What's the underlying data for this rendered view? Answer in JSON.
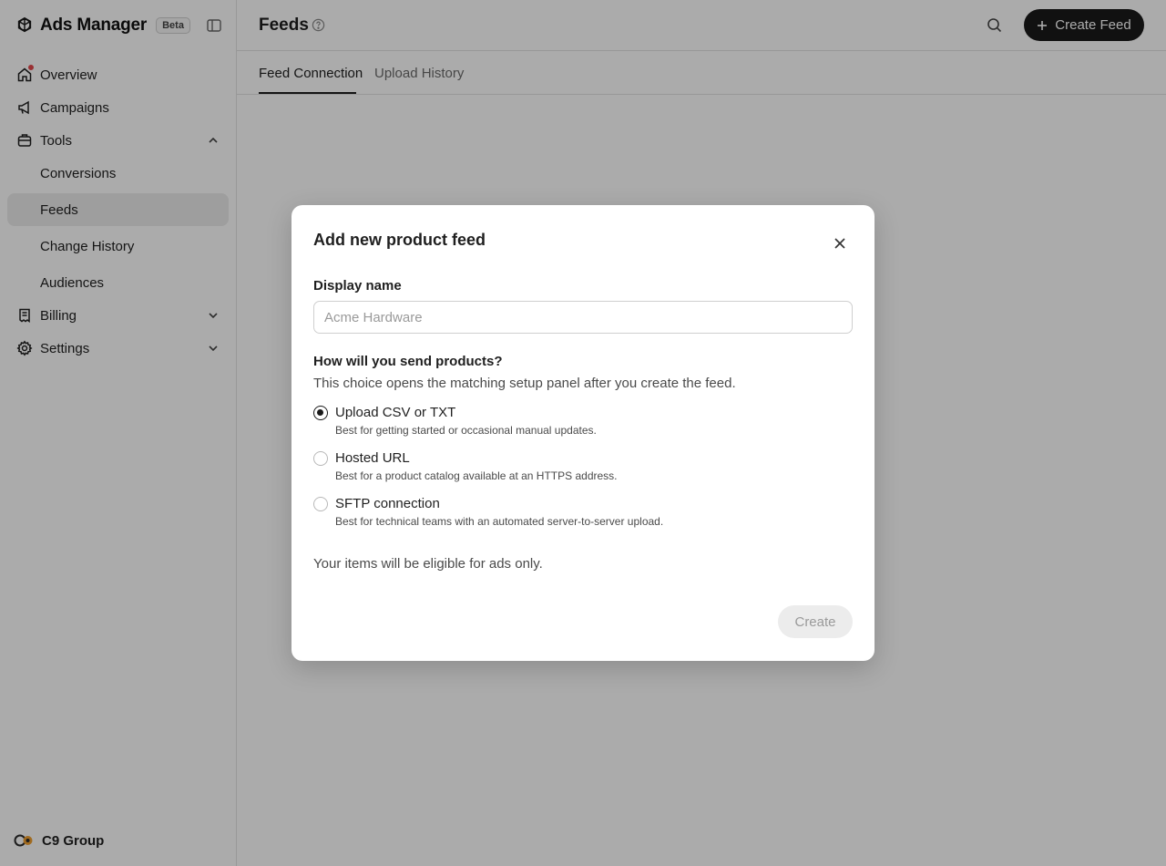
{
  "app": {
    "title": "Ads Manager",
    "badge": "Beta"
  },
  "sidebar": {
    "items": [
      {
        "label": "Overview",
        "icon": "home-icon"
      },
      {
        "label": "Campaigns",
        "icon": "megaphone-icon"
      },
      {
        "label": "Tools",
        "icon": "toolbox-icon",
        "expanded": true
      }
    ],
    "tools_children": [
      {
        "label": "Conversions"
      },
      {
        "label": "Feeds",
        "active": true
      },
      {
        "label": "Change History"
      },
      {
        "label": "Audiences"
      }
    ],
    "bottom_items": [
      {
        "label": "Billing",
        "icon": "receipt-icon"
      },
      {
        "label": "Settings",
        "icon": "gear-icon"
      }
    ],
    "account": {
      "name": "C9 Group"
    }
  },
  "header": {
    "title": "Feeds",
    "create_button": "Create Feed"
  },
  "tabs": [
    {
      "label": "Feed Connection",
      "active": true
    },
    {
      "label": "Upload History",
      "active": false
    }
  ],
  "modal": {
    "title": "Add new product feed",
    "display_name_label": "Display name",
    "display_name_placeholder": "Acme Hardware",
    "display_name_value": "",
    "question": "How will you send products?",
    "question_help": "This choice opens the matching setup panel after you create the feed.",
    "options": [
      {
        "label": "Upload CSV or TXT",
        "desc": "Best for getting started or occasional manual updates.",
        "selected": true
      },
      {
        "label": "Hosted URL",
        "desc": "Best for a product catalog available at an HTTPS address.",
        "selected": false
      },
      {
        "label": "SFTP connection",
        "desc": "Best for technical teams with an automated server-to-server upload.",
        "selected": false
      }
    ],
    "eligibility_note": "Your items will be eligible for ads only.",
    "create_button": "Create",
    "create_enabled": false
  },
  "colors": {
    "notification_dot": "#e5484d",
    "primary_button": "#1a1a1a",
    "active_nav_bg": "#ececec"
  }
}
